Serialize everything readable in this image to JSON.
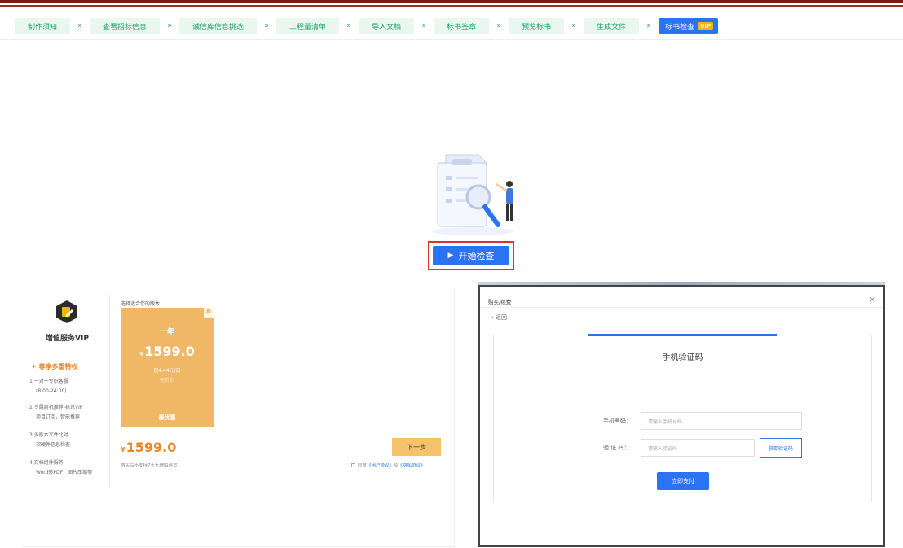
{
  "steps": [
    {
      "label": "制作须知"
    },
    {
      "label": "查看招标信息"
    },
    {
      "label": "诚信库信息挑选"
    },
    {
      "label": "工程量清单"
    },
    {
      "label": "导入文档"
    },
    {
      "label": "标书签章"
    },
    {
      "label": "预览标书"
    },
    {
      "label": "生成文件"
    },
    {
      "label": "标书检查",
      "badge": "VIP"
    }
  ],
  "step_arrow": "»",
  "main": {
    "start_button": "开始检查",
    "play_glyph": "▶"
  },
  "vip": {
    "name": "增值服务VIP",
    "rights_title": "尊享多重特权",
    "rights": [
      "1.一对一专职客服",
      "(8:00-24:00)",
      "2.专属商机推荐-标讯VIP",
      "项目订阅，智能推荐",
      "3.多版本文件比对",
      "软硬件信息检查",
      "4.文档组件服务",
      "Word转PDF，图片压缩等"
    ],
    "plan_label": "选择适合您的版本",
    "plan": {
      "corner": "荐",
      "name": "一年",
      "currency": "¥",
      "price": "1599.0",
      "daily": "仅4.44元/日",
      "discount": "无折扣",
      "best": "最优惠"
    },
    "total_currency": "¥",
    "total_price": "1599.0",
    "refund_note": "购买后不支持7天无理由退货",
    "next_button": "下一步",
    "agree_prefix": "同意",
    "user_agreement": "《用户协议》",
    "agree_and": "及",
    "privacy_agreement": "《隐私协议》"
  },
  "dialog": {
    "title": "购买/续费",
    "close": "×",
    "back": "‹ 返回",
    "heading": "手机验证码",
    "phone_label": "手机号码：",
    "phone_placeholder": "请输入手机号码",
    "code_label": "验 证 码：",
    "code_placeholder": "请输入验证码",
    "get_code_button": "获取验证码",
    "pay_button": "立即支付"
  },
  "colors": {
    "primary": "#2b73f0",
    "step_green": "#21a06a",
    "vip_orange": "#f0b866",
    "highlight_red": "#d9332b"
  }
}
